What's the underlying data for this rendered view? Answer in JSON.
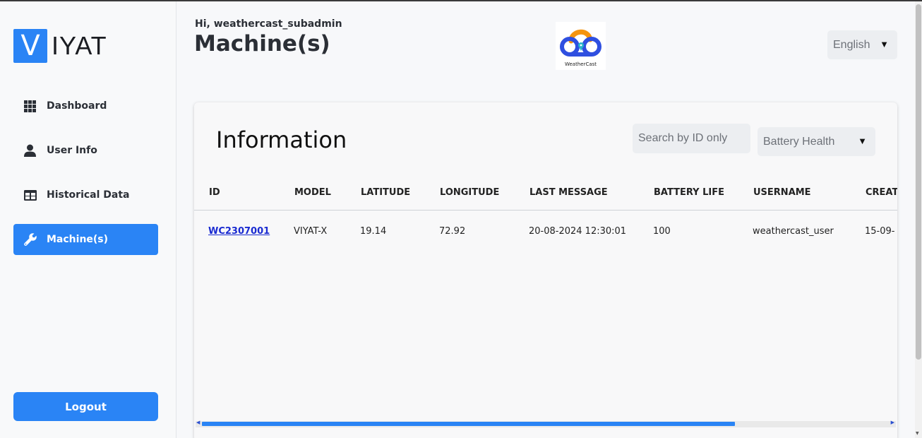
{
  "brand": {
    "logo_letter": "V",
    "logo_text": "IYAT"
  },
  "sidebar": {
    "items": [
      {
        "label": "Dashboard",
        "icon": "grid-icon"
      },
      {
        "label": "User Info",
        "icon": "user-icon"
      },
      {
        "label": "Historical Data",
        "icon": "table-icon"
      },
      {
        "label": "Machine(s)",
        "icon": "wrench-icon",
        "active": true
      }
    ],
    "logout_label": "Logout"
  },
  "header": {
    "greeting": "Hi, weathercast_subadmin",
    "title": "Machine(s)",
    "partner_logo_caption": "WeatherCast",
    "language": "English"
  },
  "card": {
    "title": "Information",
    "search_placeholder": "Search by ID only",
    "filter_value": "Battery Health"
  },
  "table": {
    "columns": [
      "ID",
      "MODEL",
      "LATITUDE",
      "LONGITUDE",
      "LAST MESSAGE",
      "BATTERY LIFE",
      "USERNAME",
      "CREAT"
    ],
    "rows": [
      [
        "WC2307001",
        "VIYAT-X",
        "19.14",
        "72.92",
        "20-08-2024 12:30:01",
        "100",
        "weathercast_user",
        "15-09-"
      ]
    ]
  },
  "colors": {
    "accent": "#2a84f5",
    "link": "#1a2bd1"
  }
}
